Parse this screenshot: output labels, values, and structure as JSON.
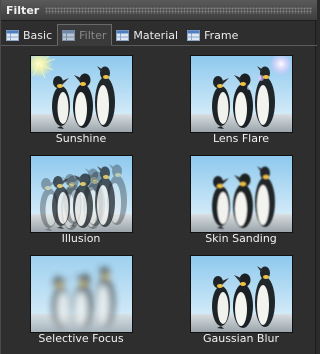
{
  "panel": {
    "title": "Filter"
  },
  "tabs": [
    {
      "label": "Basic",
      "icon": "table-icon",
      "active": false
    },
    {
      "label": "Filter",
      "icon": "table-icon",
      "active": true
    },
    {
      "label": "Material",
      "icon": "table-icon",
      "active": false
    },
    {
      "label": "Frame",
      "icon": "table-icon",
      "active": false
    }
  ],
  "filters": [
    {
      "label": "Sunshine",
      "effect": "sunshine"
    },
    {
      "label": "Lens Flare",
      "effect": "lens-flare"
    },
    {
      "label": "Illusion",
      "effect": "illusion"
    },
    {
      "label": "Skin Sanding",
      "effect": "skin-sanding"
    },
    {
      "label": "Selective Focus",
      "effect": "selective-focus"
    },
    {
      "label": "Gaussian Blur",
      "effect": "gaussian-blur"
    }
  ],
  "colors": {
    "background": "#2e2e2e",
    "text": "#f2f2f2",
    "active_tab_text": "#8a8a8a",
    "sky": "#bfe3f7",
    "ground": "#cfd6da"
  }
}
